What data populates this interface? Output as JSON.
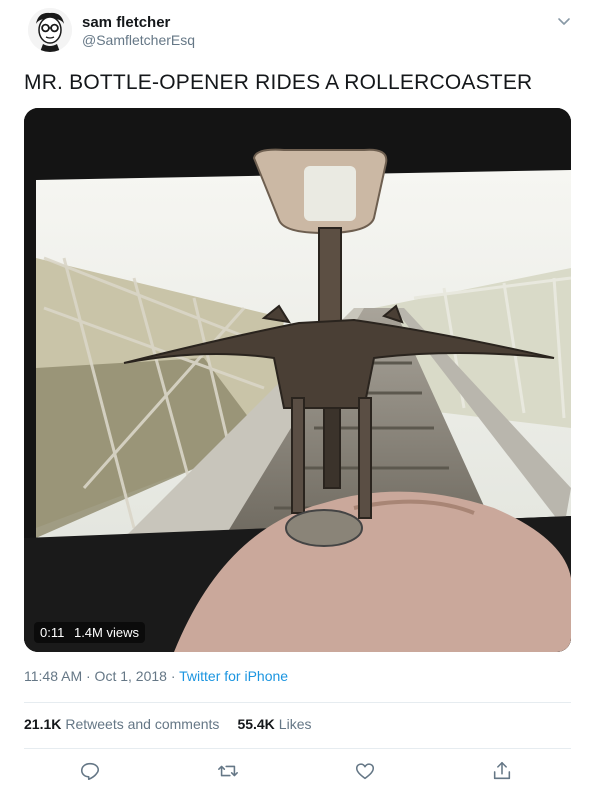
{
  "author": {
    "name": "sam fletcher",
    "handle": "@SamfletcherEsq"
  },
  "tweet": {
    "text": "MR. BOTTLE-OPENER RIDES A ROLLERCOASTER"
  },
  "video": {
    "time": "0:11",
    "views": "1.4M views"
  },
  "meta": {
    "timestamp": "11:48 AM · Oct 1, 2018",
    "separator": " · ",
    "source": "Twitter for iPhone"
  },
  "stats": {
    "retweets_count": "21.1K",
    "retweets_label": "Retweets and comments",
    "likes_count": "55.4K",
    "likes_label": "Likes"
  },
  "colors": {
    "link": "#1b95e0",
    "secondary_text": "#657786",
    "divider": "#e6ecf0"
  },
  "icons": [
    "chevron-down-icon",
    "reply-icon",
    "retweet-icon",
    "like-icon",
    "share-icon"
  ]
}
